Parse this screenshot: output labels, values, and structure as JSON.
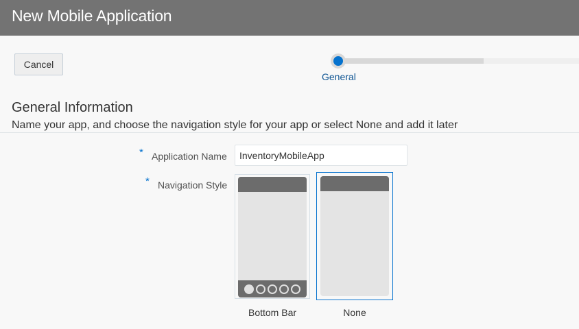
{
  "header": {
    "title": "New Mobile Application"
  },
  "toolbar": {
    "cancel_label": "Cancel"
  },
  "train": {
    "steps": [
      {
        "label": "General",
        "current": true
      }
    ]
  },
  "section": {
    "title": "General Information",
    "description": "Name your app, and choose the navigation style for your app or select None and add it later"
  },
  "form": {
    "required_marker": "*",
    "app_name": {
      "label": "Application Name",
      "value": "InventoryMobileApp"
    },
    "nav_style": {
      "label": "Navigation Style",
      "options": [
        {
          "label": "Bottom Bar",
          "selected": false
        },
        {
          "label": "None",
          "selected": true
        }
      ]
    }
  },
  "colors": {
    "accent": "#0572ce",
    "header_bg": "#737373",
    "train_label": "#0c5392"
  }
}
